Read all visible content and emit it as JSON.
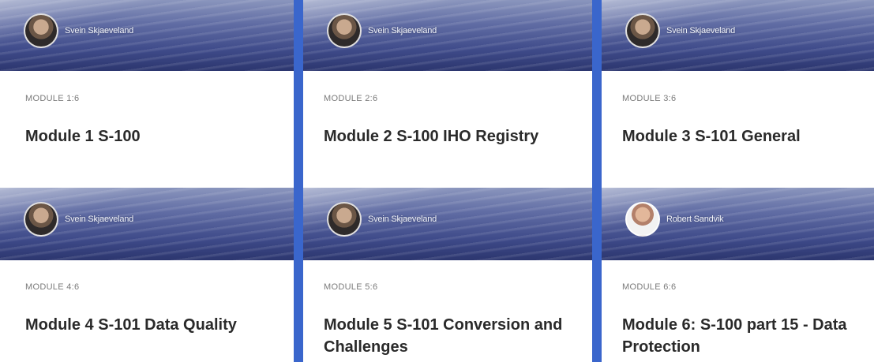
{
  "modules": [
    {
      "author": "Svein Skjaeveland",
      "label": "MODULE 1:6",
      "title": "Module 1 S-100",
      "avatar": "person-photo"
    },
    {
      "author": "Svein Skjaeveland",
      "label": "MODULE 2:6",
      "title": "Module 2 S-100 IHO Registry",
      "avatar": "person-photo"
    },
    {
      "author": "Svein Skjaeveland",
      "label": "MODULE 3:6",
      "title": "Module 3 S-101 General",
      "avatar": "person-photo"
    },
    {
      "author": "Svein Skjaeveland",
      "label": "MODULE 4:6",
      "title": "Module 4 S-101 Data Quality",
      "avatar": "person-photo"
    },
    {
      "author": "Svein Skjaeveland",
      "label": "MODULE 5:6",
      "title": "Module 5 S-101 Conversion and Challenges",
      "avatar": "person-photo"
    },
    {
      "author": "Robert Sandvik",
      "label": "MODULE 6:6",
      "title": "Module 6: S-100 part 15 - Data Protection",
      "avatar": "person-photo"
    }
  ],
  "colors": {
    "accent_rule": "#3a66cc",
    "title": "#2a2a2a",
    "label": "#7a7a7a"
  }
}
